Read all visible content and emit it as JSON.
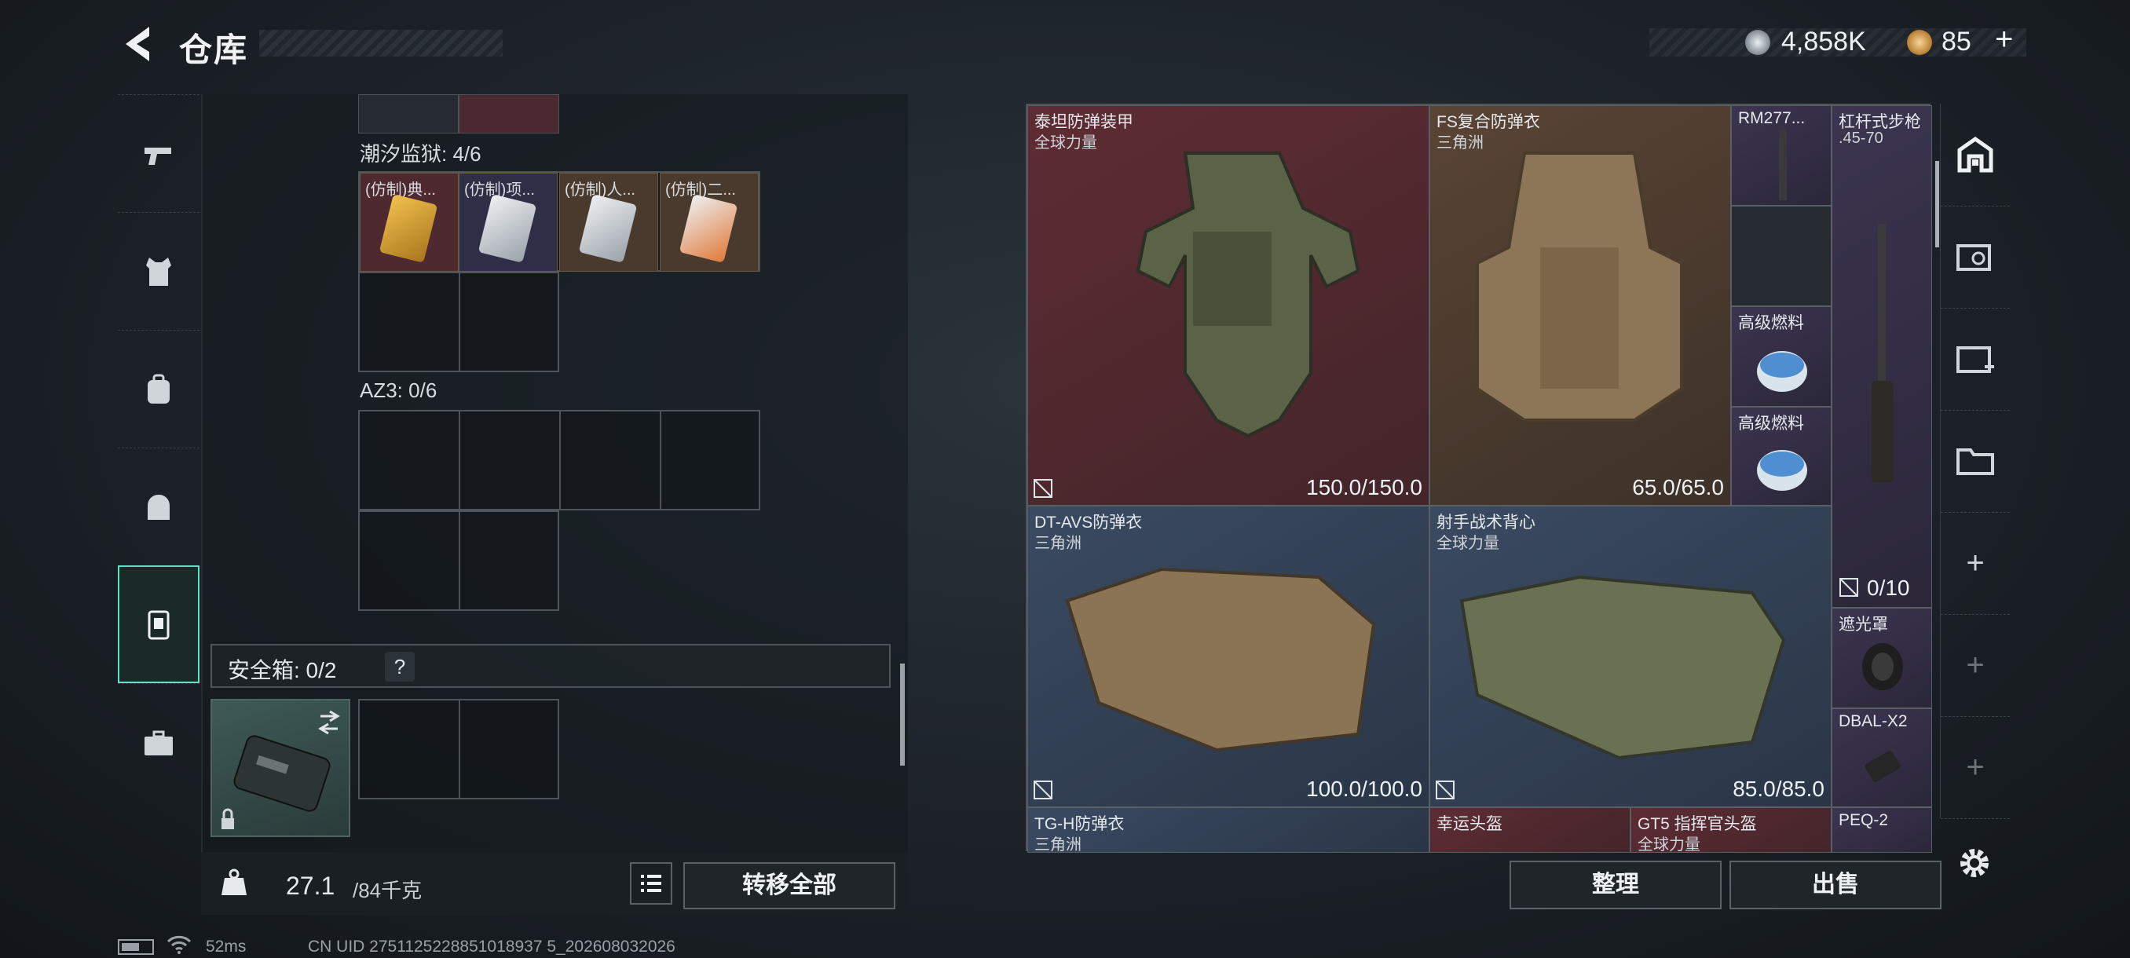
{
  "header": {
    "title": "仓库",
    "currency1": "4,858K",
    "currency2": "85",
    "currency2_plus": "+"
  },
  "sidebar": {
    "items": [
      {
        "icon": "pistol-icon"
      },
      {
        "icon": "vest-icon"
      },
      {
        "icon": "backpack-icon"
      },
      {
        "icon": "pouch-icon"
      },
      {
        "icon": "safebox-icon",
        "active": true
      },
      {
        "icon": "toolbox-icon"
      }
    ]
  },
  "left": {
    "section1_label": "潮汐监狱: 4/6",
    "section1_items": [
      "(仿制)典...",
      "(仿制)项...",
      "(仿制)人...",
      "(仿制)二..."
    ],
    "section2_label": "AZ3: 0/6",
    "safebox_label": "安全箱: 0/2",
    "safebox_help": "?",
    "weight_value": "27.1",
    "weight_unit": "/84千克",
    "transfer_all": "转移全部"
  },
  "right": {
    "items": [
      {
        "name": "泰坦防弹装甲",
        "sub": "全球力量",
        "dur": "150.0/150.0"
      },
      {
        "name": "FS复合防弹衣",
        "sub": "三角洲",
        "dur": "65.0/65.0"
      },
      {
        "name": "RM277...",
        "sub": ""
      },
      {
        "name": "杠杆式步枪",
        "sub": ".45-70",
        "dur": "0/10"
      },
      {
        "name": "高级燃料",
        "sub": ""
      },
      {
        "name": "高级燃料",
        "sub": ""
      },
      {
        "name": "DT-AVS防弹衣",
        "sub": "三角洲",
        "dur": "100.0/100.0"
      },
      {
        "name": "射手战术背心",
        "sub": "全球力量",
        "dur": "85.0/85.0"
      },
      {
        "name": "遮光罩",
        "sub": ""
      },
      {
        "name": "DBAL-X2",
        "sub": ""
      },
      {
        "name": "TG-H防弹衣",
        "sub": "三角洲"
      },
      {
        "name": "幸运头盔",
        "sub": ""
      },
      {
        "name": "GT5 指挥官头盔",
        "sub": "全球力量"
      },
      {
        "name": "PEQ-2",
        "sub": ""
      }
    ],
    "sort": "整理",
    "sell": "出售",
    "toolbar_plus": [
      "+",
      "+",
      "+"
    ]
  },
  "status": {
    "ping": "52ms",
    "uid": "CN UID 2751125228851018937 5_202608032026"
  }
}
